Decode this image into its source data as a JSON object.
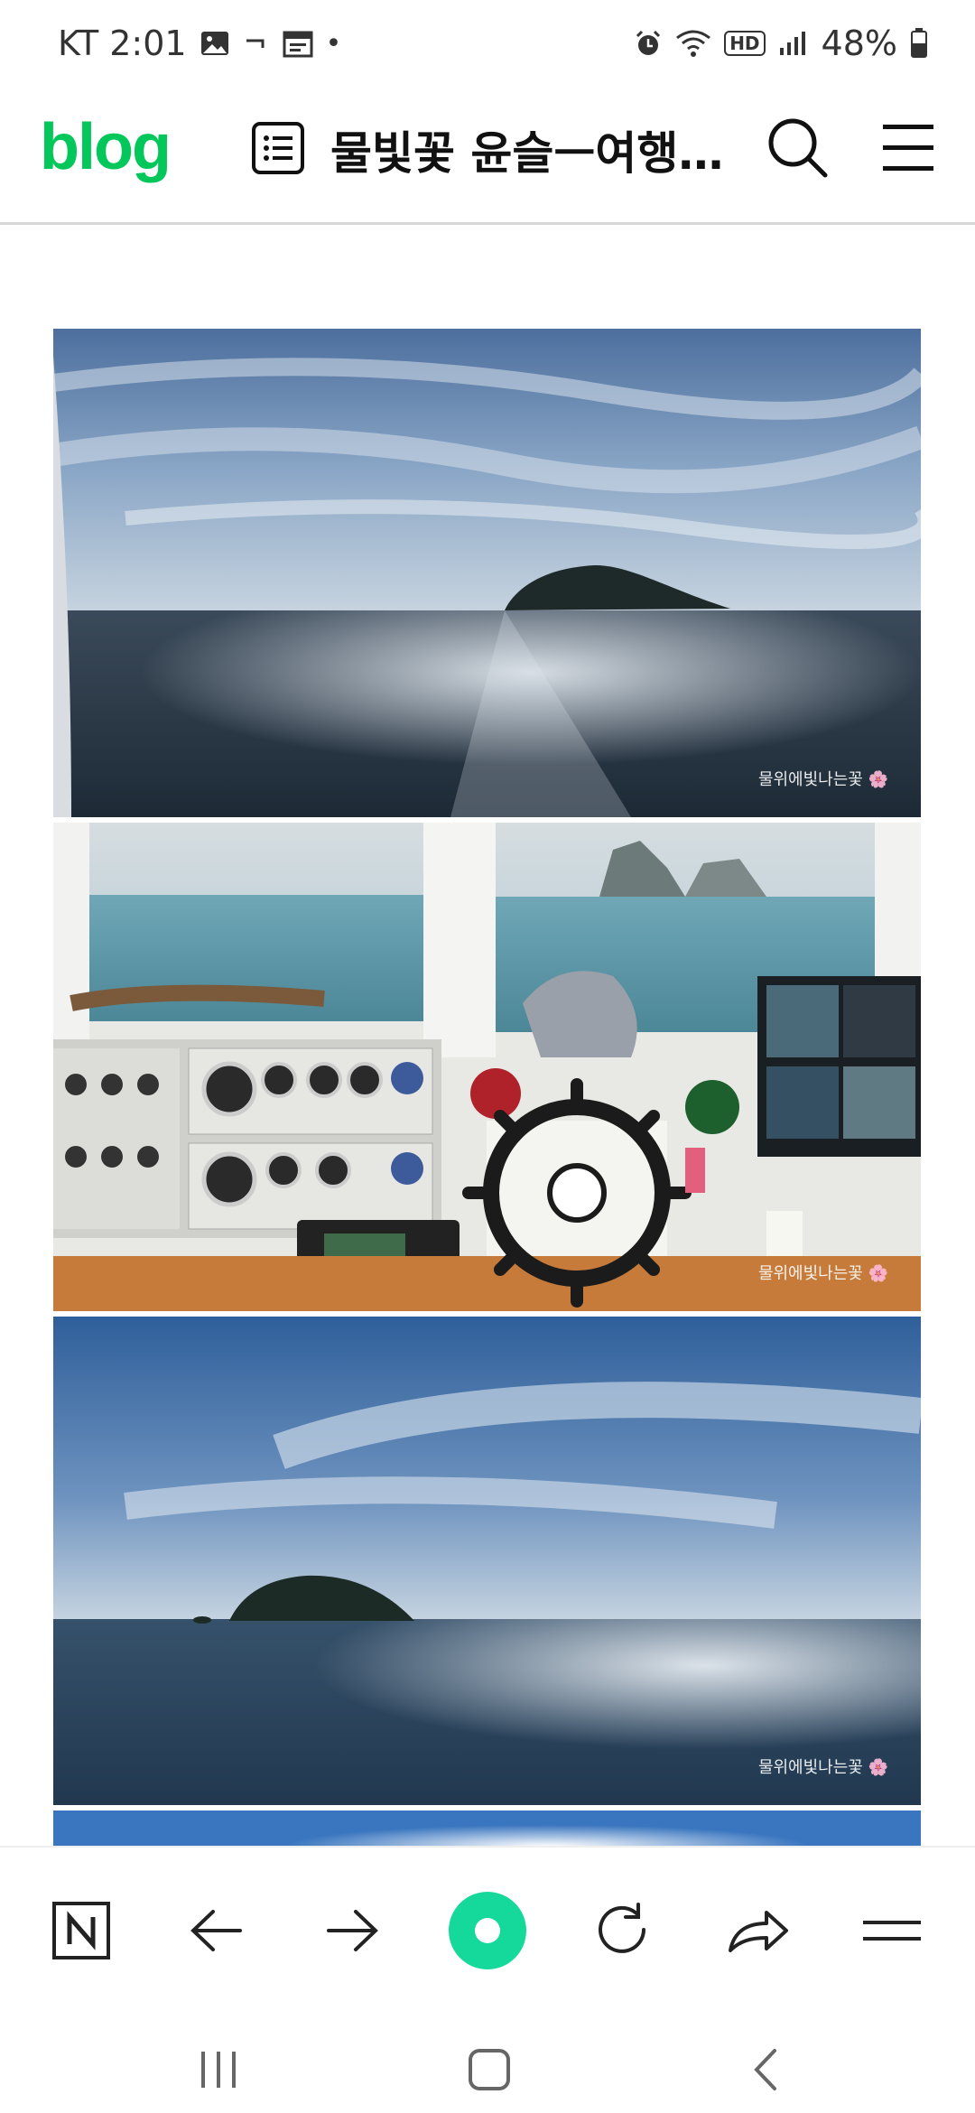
{
  "status_bar": {
    "carrier_time": "KT 2:01",
    "battery": "48%",
    "hd_badge": "HD"
  },
  "header": {
    "logo": "blog",
    "title": "물빛꽃 윤슬ㅡ여행/..."
  },
  "photos": [
    {
      "watermark": "물위에빛나는꽃 🌸",
      "alt": "sea-island-sky"
    },
    {
      "watermark": "물위에빛나는꽃 🌸",
      "alt": "ship-cockpit"
    },
    {
      "watermark": "물위에빛나는꽃 🌸",
      "alt": "sea-island-2"
    }
  ],
  "colors": {
    "brand": "#03c75a",
    "accent_center": "#14d99a"
  },
  "toolbar": {
    "items": [
      "naver-home",
      "back",
      "forward",
      "green-dot",
      "reload",
      "share",
      "menu"
    ]
  }
}
